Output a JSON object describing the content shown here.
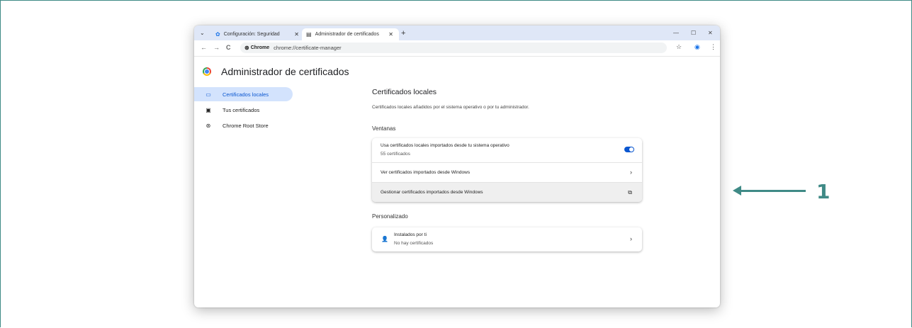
{
  "browser": {
    "tabs": [
      {
        "icon": "gear-icon",
        "label": "Configuración: Seguridad",
        "close": "✕"
      },
      {
        "icon": "certificate-icon",
        "label": "Administrador de certificados",
        "close": "✕"
      }
    ],
    "new_tab": "+",
    "window_controls": {
      "minimize": "—",
      "maximize": "☐",
      "close": "✕"
    },
    "nav": {
      "back": "←",
      "forward": "→",
      "reload": "C"
    },
    "chip_label": "Chrome",
    "url": "chrome://certificate-manager",
    "star": "☆",
    "menu": "⋮"
  },
  "app": {
    "title": "Administrador de certificados",
    "sidebar": [
      {
        "icon": "laptop-icon",
        "label": "Certificados locales",
        "selected": true
      },
      {
        "icon": "id-card-icon",
        "label": "Tus certificados",
        "selected": false
      },
      {
        "icon": "chrome-icon",
        "label": "Chrome Root Store",
        "selected": false
      }
    ],
    "main": {
      "title": "Certificados locales",
      "description": "Certificados locales añadidos por el sistema operativo o por tu administrador.",
      "section_windows": "Ventanas",
      "use_os_title": "Usa certificados locales importados desde tu sistema operativo",
      "use_os_count": "55 certificados",
      "use_os_enabled": true,
      "view_windows": "Ver certificados importados desde Windows",
      "manage_windows": "Gestionar certificados importados desde Windows",
      "section_custom": "Personalizado",
      "installed_title": "Instalados por ti",
      "installed_sub": "No hay certificados"
    }
  },
  "callout": {
    "number": "1",
    "color": "#3f8a86"
  }
}
